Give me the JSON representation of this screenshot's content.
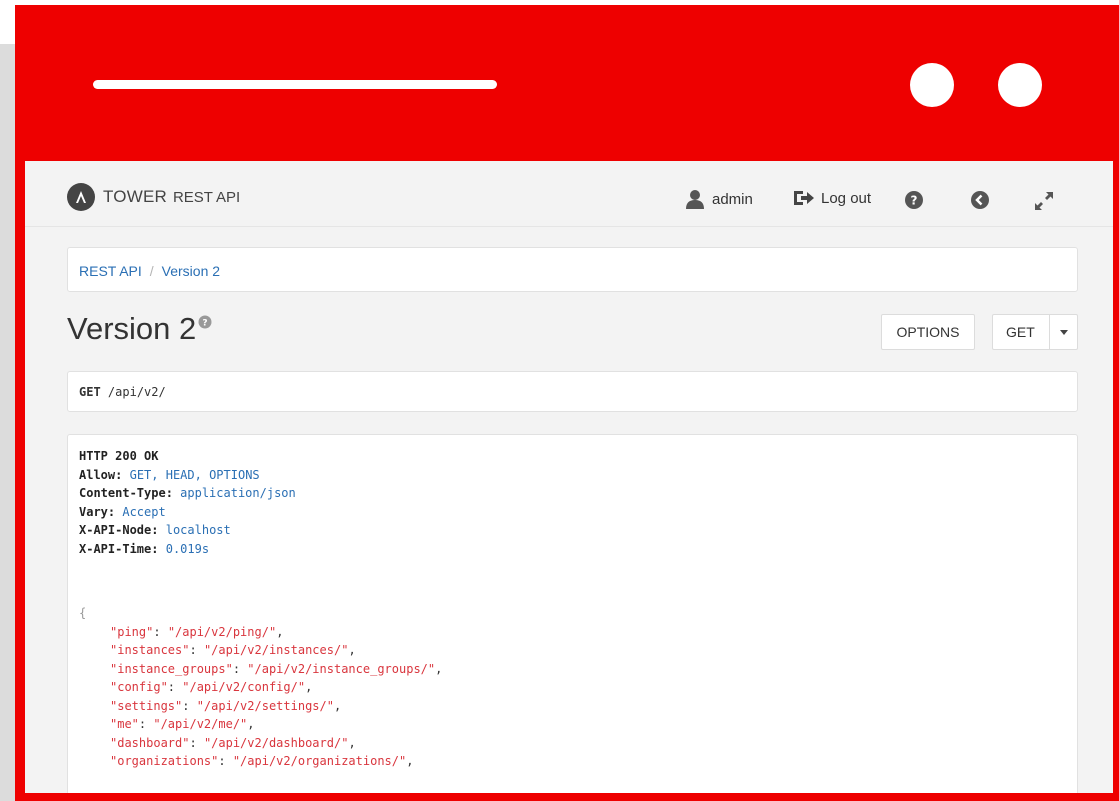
{
  "brand": {
    "name": "TOWER",
    "subtitle": "REST API"
  },
  "nav": {
    "user": "admin",
    "logout": "Log out"
  },
  "breadcrumb": {
    "root": "REST API",
    "current": "Version 2"
  },
  "page": {
    "title": "Version 2"
  },
  "actions": {
    "options": "OPTIONS",
    "get": "GET"
  },
  "request": {
    "method": "GET",
    "path": "/api/v2/"
  },
  "response": {
    "status": "HTTP 200 OK",
    "headers": [
      {
        "name": "Allow:",
        "value": "GET, HEAD, OPTIONS"
      },
      {
        "name": "Content-Type:",
        "value": "application/json"
      },
      {
        "name": "Vary:",
        "value": "Accept"
      },
      {
        "name": "X-API-Node:",
        "value": "localhost"
      },
      {
        "name": "X-API-Time:",
        "value": "0.019s"
      }
    ],
    "body_open": "{",
    "body": [
      {
        "key": "\"ping\"",
        "value": "\"/api/v2/ping/\""
      },
      {
        "key": "\"instances\"",
        "value": "\"/api/v2/instances/\""
      },
      {
        "key": "\"instance_groups\"",
        "value": "\"/api/v2/instance_groups/\""
      },
      {
        "key": "\"config\"",
        "value": "\"/api/v2/config/\""
      },
      {
        "key": "\"settings\"",
        "value": "\"/api/v2/settings/\""
      },
      {
        "key": "\"me\"",
        "value": "\"/api/v2/me/\""
      },
      {
        "key": "\"dashboard\"",
        "value": "\"/api/v2/dashboard/\""
      },
      {
        "key": "\"organizations\"",
        "value": "\"/api/v2/organizations/\""
      }
    ]
  },
  "colors": {
    "frame": "#ee0000",
    "link": "#2a6fb4",
    "json_string": "#d9363e"
  },
  "icons": [
    "ansible-logo-icon",
    "user-icon",
    "logout-icon",
    "help-circle-icon",
    "back-arrow-icon",
    "expand-icon",
    "help-small-icon",
    "caret-down-icon"
  ]
}
